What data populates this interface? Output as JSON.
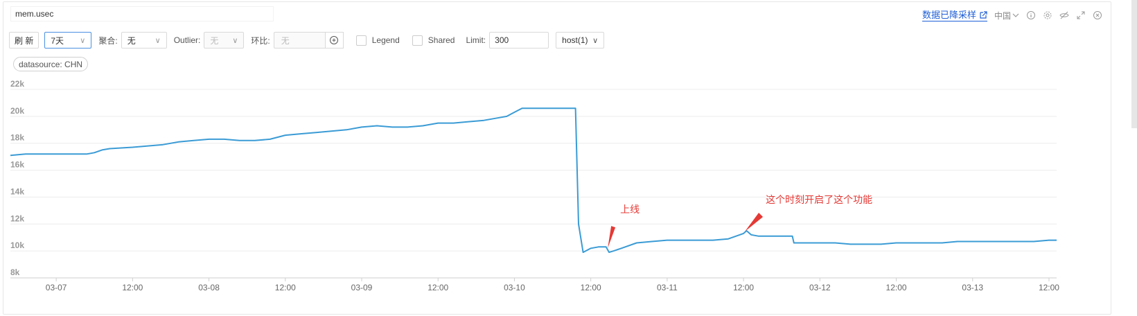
{
  "panel": {
    "title_value": "mem.usec",
    "sampled_link": "数据已降采样",
    "region": "中国"
  },
  "toolbar": {
    "refresh_label": "刷 新",
    "range_value": "7天",
    "aggregate_label": "聚合:",
    "aggregate_value": "无",
    "outlier_label": "Outlier:",
    "outlier_value": "无",
    "compare_label": "环比:",
    "compare_placeholder": "无",
    "legend_label": "Legend",
    "shared_label": "Shared",
    "limit_label": "Limit:",
    "limit_value": "300",
    "host_value": "host(1)"
  },
  "filters": {
    "datasource_tag": "datasource: CHN"
  },
  "chart_data": {
    "type": "line",
    "ylim": [
      8000,
      22000
    ],
    "y_ticks": [
      8000,
      10000,
      12000,
      14000,
      16000,
      18000,
      20000,
      22000
    ],
    "y_tick_labels": [
      "8k",
      "10k",
      "12k",
      "14k",
      "16k",
      "18k",
      "20k",
      "22k"
    ],
    "x_range": [
      -0.3,
      6.55
    ],
    "x_ticks": [
      0,
      0.5,
      1,
      1.5,
      2,
      2.5,
      3,
      3.5,
      4,
      4.5,
      5,
      5.5,
      6,
      6.5
    ],
    "x_tick_labels": [
      "03-07",
      "12:00",
      "03-08",
      "12:00",
      "03-09",
      "12:00",
      "03-10",
      "12:00",
      "03-11",
      "12:00",
      "03-12",
      "12:00",
      "03-13",
      "12:00"
    ],
    "grid": true,
    "color": "#3a9bd5",
    "series": [
      {
        "x": [
          -0.3,
          -0.2,
          -0.1,
          0.0,
          0.1,
          0.15,
          0.2,
          0.25,
          0.3,
          0.35,
          0.5,
          0.6,
          0.7,
          0.8,
          0.9,
          1.0,
          1.1,
          1.2,
          1.3,
          1.4,
          1.5,
          1.6,
          1.7,
          1.8,
          1.9,
          2.0,
          2.1,
          2.2,
          2.3,
          2.4,
          2.5,
          2.6,
          2.7,
          2.8,
          2.9,
          2.95,
          3.0,
          3.05,
          3.1,
          3.2,
          3.3,
          3.35,
          3.4,
          3.42,
          3.45,
          3.5,
          3.55,
          3.6,
          3.62,
          3.65,
          3.7,
          3.8,
          3.9,
          4.0,
          4.1,
          4.2,
          4.3,
          4.4,
          4.5,
          4.52,
          4.55,
          4.6,
          4.7,
          4.8,
          4.82,
          4.83,
          4.9,
          5.0,
          5.1,
          5.2,
          5.3,
          5.4,
          5.5,
          5.6,
          5.7,
          5.8,
          5.9,
          6.0,
          6.1,
          6.2,
          6.3,
          6.4,
          6.5,
          6.55
        ],
        "y": [
          17100,
          17200,
          17200,
          17200,
          17200,
          17200,
          17200,
          17300,
          17500,
          17600,
          17700,
          17800,
          17900,
          18100,
          18200,
          18300,
          18300,
          18200,
          18200,
          18300,
          18600,
          18700,
          18800,
          18900,
          19000,
          19200,
          19300,
          19200,
          19200,
          19300,
          19500,
          19500,
          19600,
          19700,
          19900,
          20000,
          20300,
          20600,
          20600,
          20600,
          20600,
          20600,
          20600,
          12000,
          9900,
          10200,
          10300,
          10300,
          9900,
          10000,
          10200,
          10600,
          10700,
          10800,
          10800,
          10800,
          10800,
          10900,
          11300,
          11500,
          11200,
          11100,
          11100,
          11100,
          11100,
          10600,
          10600,
          10600,
          10600,
          10500,
          10500,
          10500,
          10600,
          10600,
          10600,
          10600,
          10700,
          10700,
          10700,
          10700,
          10700,
          10700,
          10800,
          10800
        ]
      }
    ],
    "annotations": [
      {
        "text": "上线",
        "x": 3.62,
        "y": 9900
      },
      {
        "text": "这个时刻开启了这个功能",
        "x": 4.5,
        "y": 11500
      }
    ]
  }
}
